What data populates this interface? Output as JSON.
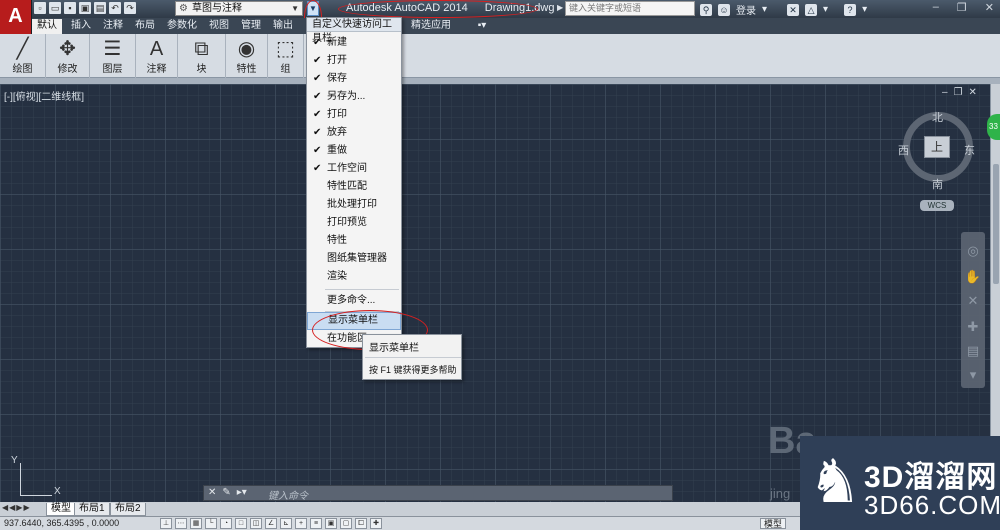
{
  "titlebar": {
    "app_letter": "A",
    "workspace": "草图与注释",
    "app_name": "Autodesk AutoCAD 2014",
    "document": "Drawing1.dwg",
    "search_placeholder": "键入关键字或短语",
    "sign_in": "登录",
    "help": "?",
    "quick_access_icons": [
      "new-icon",
      "open-icon",
      "save-icon",
      "save-as-icon",
      "print-icon",
      "undo-icon",
      "redo-icon"
    ]
  },
  "ribbon_tabs": [
    "默认",
    "插入",
    "注释",
    "布局",
    "参数化",
    "视图",
    "管理",
    "输出",
    "精选应用"
  ],
  "ribbon_panels": [
    "绘图",
    "修改",
    "图层",
    "注释",
    "块",
    "特性",
    "组"
  ],
  "viewport": {
    "label": "[-][俯视][二维线框]",
    "compass_n": "北",
    "compass_s": "南",
    "compass_e": "东",
    "compass_w": "西",
    "cube_face": "上",
    "wcs": "WCS",
    "badge": "33"
  },
  "qa_menu": {
    "header": "自定义快速访问工具栏",
    "items": [
      {
        "label": "新建",
        "checked": "✔"
      },
      {
        "label": "打开",
        "checked": "✔"
      },
      {
        "label": "保存",
        "checked": "✔"
      },
      {
        "label": "另存为...",
        "checked": "✔"
      },
      {
        "label": "打印",
        "checked": "✔"
      },
      {
        "label": "放弃",
        "checked": "✔"
      },
      {
        "label": "重做",
        "checked": "✔"
      },
      {
        "label": "工作空间",
        "checked": "✔"
      },
      {
        "label": "特性匹配",
        "checked": ""
      },
      {
        "label": "批处理打印",
        "checked": ""
      },
      {
        "label": "打印预览",
        "checked": ""
      },
      {
        "label": "特性",
        "checked": ""
      },
      {
        "label": "图纸集管理器",
        "checked": ""
      },
      {
        "label": "渲染",
        "checked": ""
      }
    ],
    "more_commands": "更多命令...",
    "show_menubar": "显示菜单栏",
    "ribbon_below": "在功能区"
  },
  "tooltip": {
    "title": "显示菜单栏",
    "help": "按 F1 键获得更多帮助"
  },
  "command_line": {
    "placeholder": "键入命令"
  },
  "layout_tabs": [
    "模型",
    "布局1",
    "布局2"
  ],
  "status": {
    "coords": "937.6440,  365.4395 , 0.0000",
    "model": "模型"
  },
  "watermark": {
    "baidu": "Ba",
    "jingyan": "jing",
    "brand_cn": "3D溜溜网",
    "brand_en": "3D66.COM"
  }
}
